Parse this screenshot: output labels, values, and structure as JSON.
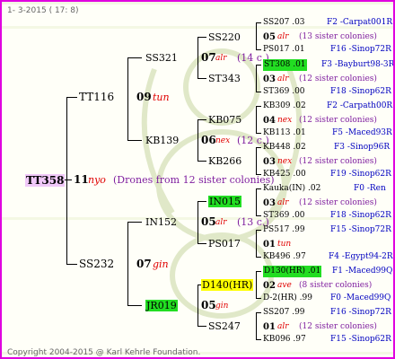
{
  "header": {
    "date": "1- 3-2015 ( 17: 8)"
  },
  "footer": {
    "copyright": "Copyright 2004-2015 @ Karl Kehrle Foundation."
  },
  "root": {
    "name": "TT358",
    "gen": "11",
    "race": "nyo",
    "note": "(Drones from 12 sister colonies)"
  },
  "gen1": [
    {
      "name": "TT116"
    },
    {
      "name": "SS232"
    }
  ],
  "gen2": [
    {
      "name": "SS321",
      "gen": "09",
      "race": "tun"
    },
    {
      "name": "KB139",
      "gen": "06",
      "race": "nex",
      "note": "(12 c.)"
    },
    {
      "name": "IN152",
      "gen": "05",
      "race": "alr",
      "note": "(13 c.)"
    },
    {
      "name": "JR019",
      "gen": "05",
      "race": "gin"
    }
  ],
  "gen2_parent": [
    {
      "gen": "07",
      "race": "alr",
      "note": "(14 c.)"
    },
    {
      "gen": "07",
      "race": "gin"
    }
  ],
  "gen3": [
    {
      "name": "SS220"
    },
    {
      "name": "ST343"
    },
    {
      "name": "KB075"
    },
    {
      "name": "KB266"
    },
    {
      "name": "IN015"
    },
    {
      "name": "PS017"
    },
    {
      "name": "D140(HR)"
    },
    {
      "name": "SS247"
    }
  ],
  "gen4": [
    {
      "name": "SS207 .03",
      "place": "F2 -Carpat001R"
    },
    {
      "mid": "05",
      "race": "alr",
      "note": "(13 sister colonies)"
    },
    {
      "name": "PS017 .01",
      "place": "F16 -Sinop72R"
    },
    {
      "name": "ST308 .01",
      "place": "F3 -Bayburt98-3R"
    },
    {
      "mid": "03",
      "race": "alr",
      "note": "(12 sister colonies)"
    },
    {
      "name": "ST369 .00",
      "place": "F18 -Sinop62R"
    },
    {
      "name": "KB309 .02",
      "place": "F2 -Carpath00R"
    },
    {
      "mid": "04",
      "race": "nex",
      "note": "(12 sister colonies)"
    },
    {
      "name": "KB113 .01",
      "place": "F5 -Maced93R"
    },
    {
      "name": "KB448 .02",
      "place": "F3 -Sinop96R"
    },
    {
      "mid": "03",
      "race": "nex",
      "note": "(12 sister colonies)"
    },
    {
      "name": "KB425 .00",
      "place": "F19 -Sinop62R"
    },
    {
      "name": "Kauka(IN) .02",
      "place": "F0 -Ren"
    },
    {
      "mid": "03",
      "race": "alr",
      "note": "(12 sister colonies)"
    },
    {
      "name": "ST369 .00",
      "place": "F18 -Sinop62R"
    },
    {
      "name": "PS517 .99",
      "place": "F15 -Sinop72R"
    },
    {
      "mid": "01",
      "race": "tun"
    },
    {
      "name": "KB496 .97",
      "place": "F4 -Egypt94-2R"
    },
    {
      "name": "D130(HR) .01",
      "place": "F1 -Maced99Q"
    },
    {
      "mid": "02",
      "race": "ave",
      "note": "(8 sister colonies)"
    },
    {
      "name": "D-2(HR) .99",
      "place": "F0 -Maced99Q"
    },
    {
      "name": "SS207 .99",
      "place": "F16 -Sinop72R"
    },
    {
      "mid": "01",
      "race": "alr",
      "note": "(12 sister colonies)"
    },
    {
      "name": "KB096 .97",
      "place": "F15 -Sinop62R"
    }
  ]
}
